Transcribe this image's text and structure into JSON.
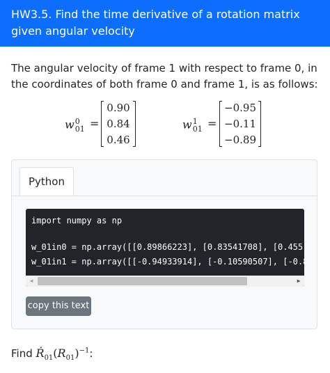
{
  "header": {
    "title": "HW3.5. Find the time derivative of a rotation matrix given angular velocity"
  },
  "intro": "The angular velocity of frame 1 with respect to frame 0, in the coordinates of both frame 0 and frame 1, is as follows:",
  "equations": {
    "w0": {
      "symbol": "w",
      "sup": "0",
      "sub": "01",
      "equals": "=",
      "values": [
        "0.90",
        "0.84",
        "0.46"
      ]
    },
    "w1": {
      "symbol": "w",
      "sup": "1",
      "sub": "01",
      "equals": "=",
      "values": [
        "−0.95",
        "−0.11",
        "−0.89"
      ]
    }
  },
  "panel": {
    "tab_label": "Python",
    "code_lines": [
      "import numpy as np",
      "w_01in0 = np.array([[0.89866223], [0.83541708], [0.455",
      "w_01in1 = np.array([[-0.94933914], [-0.10590507], [-0.8"
    ],
    "copy_label": "copy this text",
    "scroll_left_icon": "triangle-left",
    "scroll_right_icon": "triangle-right"
  },
  "find": {
    "prefix": "Find ",
    "expr_R": "Ṙ",
    "expr_sub": "01",
    "expr_paren_open": "(",
    "expr_R2": "R",
    "expr_sub2": "01",
    "expr_paren_close": ")",
    "expr_sup": "−1",
    "suffix": ":"
  }
}
